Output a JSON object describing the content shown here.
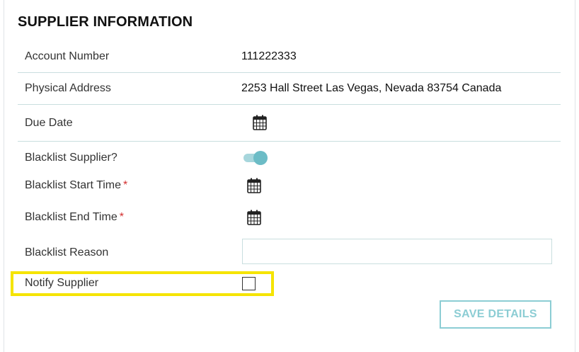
{
  "header": {
    "title": "SUPPLIER INFORMATION"
  },
  "fields": {
    "account_number": {
      "label": "Account Number",
      "value": "111222333"
    },
    "physical_address": {
      "label": "Physical Address",
      "value": "2253 Hall Street Las Vegas, Nevada 83754 Canada"
    },
    "due_date": {
      "label": "Due Date",
      "icon": "calendar-icon"
    },
    "blacklist_supplier": {
      "label": "Blacklist Supplier?",
      "toggle_on": true
    },
    "blacklist_start_time": {
      "label": "Blacklist Start Time",
      "required_mark": "*",
      "icon": "calendar-icon"
    },
    "blacklist_end_time": {
      "label": "Blacklist End Time",
      "required_mark": "*",
      "icon": "calendar-icon"
    },
    "blacklist_reason": {
      "label": "Blacklist Reason",
      "value": ""
    },
    "notify_supplier": {
      "label": "Notify Supplier",
      "checked": false
    }
  },
  "actions": {
    "save_label": "SAVE DETAILS"
  },
  "colors": {
    "accent": "#8ccdd4",
    "toggle_knob": "#6cbcc6",
    "divider": "#c9dedf",
    "highlight": "#f5e400",
    "required": "#d32f2f"
  }
}
